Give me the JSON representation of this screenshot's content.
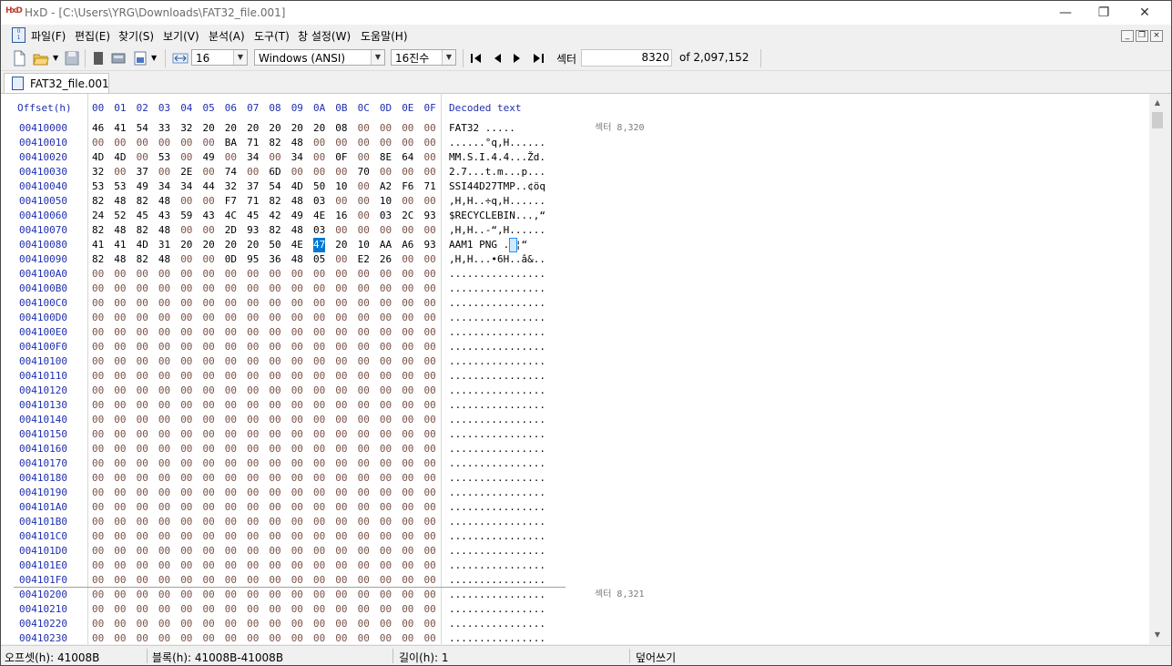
{
  "window": {
    "title": "HxD - [C:\\Users\\YRG\\Downloads\\FAT32_file.001]"
  },
  "menu": [
    "파일(F)",
    "편집(E)",
    "찾기(S)",
    "보기(V)",
    "분석(A)",
    "도구(T)",
    "창 설정(W)",
    "도움말(H)"
  ],
  "toolbar": {
    "bytes_per_row": "16",
    "charset": "Windows (ANSI)",
    "offset_base": "16진수",
    "sector_label": "섹터",
    "sector_value": "8320",
    "sector_total": "of 2,097,152"
  },
  "tab": {
    "label": "FAT32_file.001"
  },
  "hex": {
    "header_offset": "Offset(h)",
    "columns": [
      "00",
      "01",
      "02",
      "03",
      "04",
      "05",
      "06",
      "07",
      "08",
      "09",
      "0A",
      "0B",
      "0C",
      "0D",
      "0E",
      "0F"
    ],
    "header_decoded": "Decoded text",
    "selected": {
      "row": 8,
      "col": 10
    },
    "rows": [
      {
        "offset": "00410000",
        "bytes": [
          "46",
          "41",
          "54",
          "33",
          "32",
          "20",
          "20",
          "20",
          "20",
          "20",
          "20",
          "08",
          "00",
          "00",
          "00",
          "00"
        ],
        "text": "FAT32      ....."
      },
      {
        "offset": "00410010",
        "bytes": [
          "00",
          "00",
          "00",
          "00",
          "00",
          "00",
          "BA",
          "71",
          "82",
          "48",
          "00",
          "00",
          "00",
          "00",
          "00",
          "00"
        ],
        "text": "......°q,H......"
      },
      {
        "offset": "00410020",
        "bytes": [
          "4D",
          "4D",
          "00",
          "53",
          "00",
          "49",
          "00",
          "34",
          "00",
          "34",
          "00",
          "0F",
          "00",
          "8E",
          "64",
          "00"
        ],
        "text": "MM.S.I.4.4...Žd."
      },
      {
        "offset": "00410030",
        "bytes": [
          "32",
          "00",
          "37",
          "00",
          "2E",
          "00",
          "74",
          "00",
          "6D",
          "00",
          "00",
          "00",
          "70",
          "00",
          "00",
          "00"
        ],
        "text": "2.7...t.m...p..."
      },
      {
        "offset": "00410040",
        "bytes": [
          "53",
          "53",
          "49",
          "34",
          "34",
          "44",
          "32",
          "37",
          "54",
          "4D",
          "50",
          "10",
          "00",
          "A2",
          "F6",
          "71"
        ],
        "text": "SSI44D27TMP..¢öq"
      },
      {
        "offset": "00410050",
        "bytes": [
          "82",
          "48",
          "82",
          "48",
          "00",
          "00",
          "F7",
          "71",
          "82",
          "48",
          "03",
          "00",
          "00",
          "10",
          "00",
          "00"
        ],
        "text": ",H,H..÷q,H......"
      },
      {
        "offset": "00410060",
        "bytes": [
          "24",
          "52",
          "45",
          "43",
          "59",
          "43",
          "4C",
          "45",
          "42",
          "49",
          "4E",
          "16",
          "00",
          "03",
          "2C",
          "93"
        ],
        "text": "$RECYCLEBIN...,“"
      },
      {
        "offset": "00410070",
        "bytes": [
          "82",
          "48",
          "82",
          "48",
          "00",
          "00",
          "2D",
          "93",
          "82",
          "48",
          "03",
          "00",
          "00",
          "00",
          "00",
          "00"
        ],
        "text": ",H,H..-“,H......"
      },
      {
        "offset": "00410080",
        "bytes": [
          "41",
          "41",
          "4D",
          "31",
          "20",
          "20",
          "20",
          "20",
          "50",
          "4E",
          "47",
          "20",
          "10",
          "AA",
          "A6",
          "93"
        ],
        "text": "AAM1    PNG .ª¦“"
      },
      {
        "offset": "00410090",
        "bytes": [
          "82",
          "48",
          "82",
          "48",
          "00",
          "00",
          "0D",
          "95",
          "36",
          "48",
          "05",
          "00",
          "E2",
          "26",
          "00",
          "00"
        ],
        "text": ",H,H...•6H..â&.."
      },
      {
        "offset": "004100A0",
        "bytes": [
          "00",
          "00",
          "00",
          "00",
          "00",
          "00",
          "00",
          "00",
          "00",
          "00",
          "00",
          "00",
          "00",
          "00",
          "00",
          "00"
        ],
        "text": "................"
      },
      {
        "offset": "004100B0",
        "bytes": [
          "00",
          "00",
          "00",
          "00",
          "00",
          "00",
          "00",
          "00",
          "00",
          "00",
          "00",
          "00",
          "00",
          "00",
          "00",
          "00"
        ],
        "text": "................"
      },
      {
        "offset": "004100C0",
        "bytes": [
          "00",
          "00",
          "00",
          "00",
          "00",
          "00",
          "00",
          "00",
          "00",
          "00",
          "00",
          "00",
          "00",
          "00",
          "00",
          "00"
        ],
        "text": "................"
      },
      {
        "offset": "004100D0",
        "bytes": [
          "00",
          "00",
          "00",
          "00",
          "00",
          "00",
          "00",
          "00",
          "00",
          "00",
          "00",
          "00",
          "00",
          "00",
          "00",
          "00"
        ],
        "text": "................"
      },
      {
        "offset": "004100E0",
        "bytes": [
          "00",
          "00",
          "00",
          "00",
          "00",
          "00",
          "00",
          "00",
          "00",
          "00",
          "00",
          "00",
          "00",
          "00",
          "00",
          "00"
        ],
        "text": "................"
      },
      {
        "offset": "004100F0",
        "bytes": [
          "00",
          "00",
          "00",
          "00",
          "00",
          "00",
          "00",
          "00",
          "00",
          "00",
          "00",
          "00",
          "00",
          "00",
          "00",
          "00"
        ],
        "text": "................"
      },
      {
        "offset": "00410100",
        "bytes": [
          "00",
          "00",
          "00",
          "00",
          "00",
          "00",
          "00",
          "00",
          "00",
          "00",
          "00",
          "00",
          "00",
          "00",
          "00",
          "00"
        ],
        "text": "................"
      },
      {
        "offset": "00410110",
        "bytes": [
          "00",
          "00",
          "00",
          "00",
          "00",
          "00",
          "00",
          "00",
          "00",
          "00",
          "00",
          "00",
          "00",
          "00",
          "00",
          "00"
        ],
        "text": "................"
      },
      {
        "offset": "00410120",
        "bytes": [
          "00",
          "00",
          "00",
          "00",
          "00",
          "00",
          "00",
          "00",
          "00",
          "00",
          "00",
          "00",
          "00",
          "00",
          "00",
          "00"
        ],
        "text": "................"
      },
      {
        "offset": "00410130",
        "bytes": [
          "00",
          "00",
          "00",
          "00",
          "00",
          "00",
          "00",
          "00",
          "00",
          "00",
          "00",
          "00",
          "00",
          "00",
          "00",
          "00"
        ],
        "text": "................"
      },
      {
        "offset": "00410140",
        "bytes": [
          "00",
          "00",
          "00",
          "00",
          "00",
          "00",
          "00",
          "00",
          "00",
          "00",
          "00",
          "00",
          "00",
          "00",
          "00",
          "00"
        ],
        "text": "................"
      },
      {
        "offset": "00410150",
        "bytes": [
          "00",
          "00",
          "00",
          "00",
          "00",
          "00",
          "00",
          "00",
          "00",
          "00",
          "00",
          "00",
          "00",
          "00",
          "00",
          "00"
        ],
        "text": "................"
      },
      {
        "offset": "00410160",
        "bytes": [
          "00",
          "00",
          "00",
          "00",
          "00",
          "00",
          "00",
          "00",
          "00",
          "00",
          "00",
          "00",
          "00",
          "00",
          "00",
          "00"
        ],
        "text": "................"
      },
      {
        "offset": "00410170",
        "bytes": [
          "00",
          "00",
          "00",
          "00",
          "00",
          "00",
          "00",
          "00",
          "00",
          "00",
          "00",
          "00",
          "00",
          "00",
          "00",
          "00"
        ],
        "text": "................"
      },
      {
        "offset": "00410180",
        "bytes": [
          "00",
          "00",
          "00",
          "00",
          "00",
          "00",
          "00",
          "00",
          "00",
          "00",
          "00",
          "00",
          "00",
          "00",
          "00",
          "00"
        ],
        "text": "................"
      },
      {
        "offset": "00410190",
        "bytes": [
          "00",
          "00",
          "00",
          "00",
          "00",
          "00",
          "00",
          "00",
          "00",
          "00",
          "00",
          "00",
          "00",
          "00",
          "00",
          "00"
        ],
        "text": "................"
      },
      {
        "offset": "004101A0",
        "bytes": [
          "00",
          "00",
          "00",
          "00",
          "00",
          "00",
          "00",
          "00",
          "00",
          "00",
          "00",
          "00",
          "00",
          "00",
          "00",
          "00"
        ],
        "text": "................"
      },
      {
        "offset": "004101B0",
        "bytes": [
          "00",
          "00",
          "00",
          "00",
          "00",
          "00",
          "00",
          "00",
          "00",
          "00",
          "00",
          "00",
          "00",
          "00",
          "00",
          "00"
        ],
        "text": "................"
      },
      {
        "offset": "004101C0",
        "bytes": [
          "00",
          "00",
          "00",
          "00",
          "00",
          "00",
          "00",
          "00",
          "00",
          "00",
          "00",
          "00",
          "00",
          "00",
          "00",
          "00"
        ],
        "text": "................"
      },
      {
        "offset": "004101D0",
        "bytes": [
          "00",
          "00",
          "00",
          "00",
          "00",
          "00",
          "00",
          "00",
          "00",
          "00",
          "00",
          "00",
          "00",
          "00",
          "00",
          "00"
        ],
        "text": "................"
      },
      {
        "offset": "004101E0",
        "bytes": [
          "00",
          "00",
          "00",
          "00",
          "00",
          "00",
          "00",
          "00",
          "00",
          "00",
          "00",
          "00",
          "00",
          "00",
          "00",
          "00"
        ],
        "text": "................"
      },
      {
        "offset": "004101F0",
        "bytes": [
          "00",
          "00",
          "00",
          "00",
          "00",
          "00",
          "00",
          "00",
          "00",
          "00",
          "00",
          "00",
          "00",
          "00",
          "00",
          "00"
        ],
        "text": "................"
      },
      {
        "offset": "00410200",
        "bytes": [
          "00",
          "00",
          "00",
          "00",
          "00",
          "00",
          "00",
          "00",
          "00",
          "00",
          "00",
          "00",
          "00",
          "00",
          "00",
          "00"
        ],
        "text": "................"
      },
      {
        "offset": "00410210",
        "bytes": [
          "00",
          "00",
          "00",
          "00",
          "00",
          "00",
          "00",
          "00",
          "00",
          "00",
          "00",
          "00",
          "00",
          "00",
          "00",
          "00"
        ],
        "text": "................"
      },
      {
        "offset": "00410220",
        "bytes": [
          "00",
          "00",
          "00",
          "00",
          "00",
          "00",
          "00",
          "00",
          "00",
          "00",
          "00",
          "00",
          "00",
          "00",
          "00",
          "00"
        ],
        "text": "................"
      },
      {
        "offset": "00410230",
        "bytes": [
          "00",
          "00",
          "00",
          "00",
          "00",
          "00",
          "00",
          "00",
          "00",
          "00",
          "00",
          "00",
          "00",
          "00",
          "00",
          "00"
        ],
        "text": "................"
      }
    ],
    "sector_marks": [
      {
        "row": 0,
        "label": "섹터 8,320"
      },
      {
        "row": 32,
        "label": "섹터 8,321"
      }
    ]
  },
  "status": {
    "offset": "오프셋(h): 41008B",
    "block": "블록(h): 41008B-41008B",
    "length": "길이(h): 1",
    "mode": "덮어쓰기"
  }
}
